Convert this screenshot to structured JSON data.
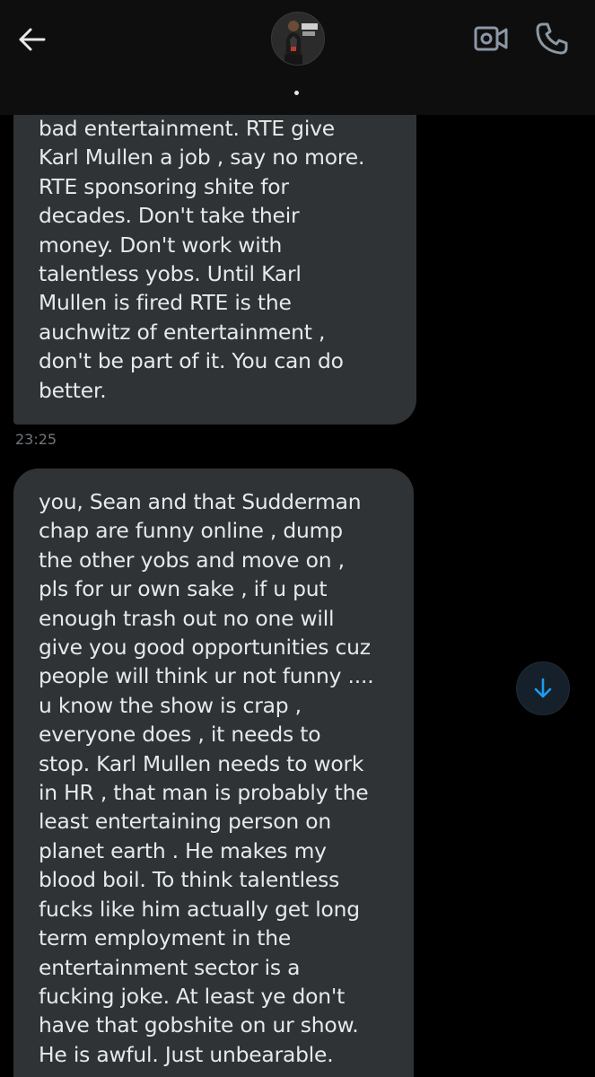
{
  "header": {
    "back_icon": "arrow-left-icon",
    "video_icon": "video-call-icon",
    "call_icon": "phone-icon"
  },
  "messages": [
    {
      "text": "bad entertainment. RTE give\nKarl Mullen a job , say no more.\nRTE sponsoring shite for\ndecades. Don't take their\nmoney. Don't work with\ntalentless yobs. Until Karl\nMullen is fired RTE is the\nauchwitz of entertainment ,\ndon't be part of it. You can do\nbetter.",
      "time": "23:25"
    },
    {
      "text": "you, Sean and that Sudderman\nchap are funny online , dump\nthe other yobs and move on ,\npls for ur own sake , if u put\nenough trash out no one will\ngive you good opportunities cuz\npeople will think ur not funny ....\nu know the show is crap ,\neveryone does , it needs to\nstop. Karl Mullen needs to work\nin HR , that man is probably the\nleast entertaining person on\nplanet earth . He makes my\nblood boil. To think talentless\nfucks like him actually get long\nterm employment in the\nentertainment sector is a\nfucking joke. At least ye don't\nhave that gobshite on ur show.\nHe is awful. Just unbearable."
    }
  ],
  "scroll_button": {
    "icon": "arrow-down-icon",
    "color": "#1d9bf0"
  },
  "colors": {
    "background": "#000000",
    "bubble": "#2f3336",
    "text": "#e7e9ea",
    "timestamp": "#71767b",
    "accent": "#1d9bf0"
  }
}
